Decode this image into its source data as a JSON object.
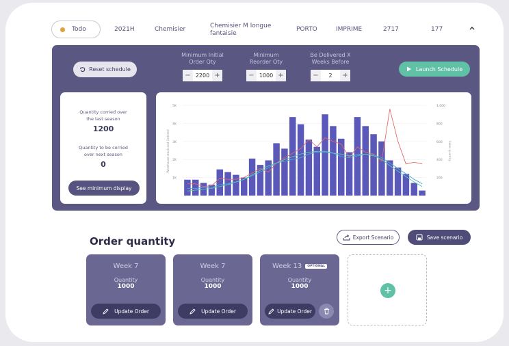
{
  "product_row": {
    "status": "Todo",
    "season": "2021H",
    "category": "Chemisier",
    "description": "Chemisier M longue fantaisie",
    "location": "PORTO",
    "print_type": "IMPRIME",
    "code": "2717",
    "quantity": "177",
    "status_color": "#e0a23c"
  },
  "controls": {
    "reset_label": "Reset schedule",
    "launch_label": "Launch Schedule",
    "params": [
      {
        "label": "Minimum Initial\nOrder Qty",
        "value": "2200"
      },
      {
        "label": "Minimum\nReorder Qty",
        "value": "1000"
      },
      {
        "label": "Be Delivered X\nWeeks Before",
        "value": "2"
      }
    ],
    "minus": "−",
    "plus": "+"
  },
  "summary": {
    "carried_last_label": "Quantity corried over the last season",
    "carried_last_value": "1200",
    "carried_next_label": "Quantity to be corried over next season",
    "carried_next_value": "0",
    "min_display_label": "See minimum display"
  },
  "chart_data": {
    "type": "bar",
    "ylabel": "Warehouse stock and Ordered",
    "y2label": "Sales quantity",
    "y_ticks": [
      "1K",
      "2K",
      "3K",
      "4K",
      "5K"
    ],
    "y2_ticks": [
      "200",
      "400",
      "600",
      "800",
      "1,000"
    ],
    "ylim": [
      0,
      5000
    ],
    "y2lim": [
      0,
      1000
    ],
    "bars": [
      880,
      880,
      700,
      600,
      1450,
      1300,
      1150,
      1000,
      2050,
      1700,
      1950,
      2900,
      2600,
      4350,
      3950,
      3100,
      2700,
      4500,
      3850,
      3150,
      2400,
      4350,
      3850,
      3400,
      3000,
      1950,
      1550,
      1200,
      700,
      280
    ],
    "series": [
      {
        "name": "sales_red",
        "color": "#e06a6a",
        "values": [
          130,
          130,
          100,
          110,
          190,
          180,
          180,
          200,
          250,
          300,
          260,
          360,
          420,
          470,
          520,
          620,
          540,
          640,
          600,
          570,
          420,
          540,
          480,
          460,
          380,
          960,
          600,
          350,
          370,
          350
        ]
      },
      {
        "name": "stock_blue",
        "color": "#4fa8d6",
        "values": [
          80,
          80,
          90,
          90,
          120,
          130,
          150,
          180,
          220,
          260,
          310,
          360,
          380,
          400,
          420,
          460,
          480,
          480,
          470,
          430,
          420,
          440,
          460,
          450,
          420,
          360,
          300,
          240,
          180,
          130
        ]
      },
      {
        "name": "ordered_teal",
        "color": "#5ec9b0",
        "values": [
          50,
          60,
          70,
          80,
          100,
          120,
          150,
          180,
          230,
          280,
          330,
          360,
          400,
          430,
          460,
          480,
          490,
          490,
          470,
          460,
          440,
          450,
          460,
          440,
          400,
          330,
          270,
          210,
          150,
          100
        ]
      }
    ],
    "bar_color": "#5a58b8"
  },
  "order_quantity": {
    "title": "Order quantity",
    "export_label": "Export Scenario",
    "save_label": "Save scenario",
    "quantity_label": "Quantity",
    "update_label": "Update Order",
    "optional_label": "OPTIONAL",
    "cards": [
      {
        "week": "Week 7",
        "quantity": "1000",
        "optional": false
      },
      {
        "week": "Week 7",
        "quantity": "1000",
        "optional": false
      },
      {
        "week": "Week 13",
        "quantity": "1000",
        "optional": true
      }
    ]
  },
  "colors": {
    "panel": "#5a5783",
    "accent": "#61c1a6"
  }
}
